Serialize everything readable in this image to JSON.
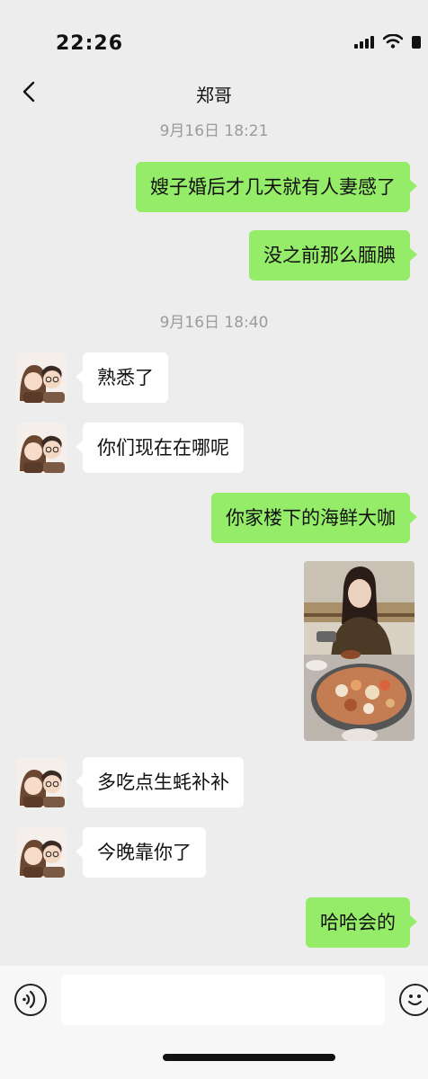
{
  "status": {
    "time": "22:26"
  },
  "nav": {
    "title": "郑哥"
  },
  "messages": [
    {
      "kind": "timestamp",
      "text": "9月16日 18:21"
    },
    {
      "kind": "out",
      "text": "嫂子婚后才几天就有人妻感了"
    },
    {
      "kind": "out",
      "text": "没之前那么腼腆"
    },
    {
      "kind": "timestamp",
      "text": "9月16日 18:40"
    },
    {
      "kind": "in",
      "text": "熟悉了"
    },
    {
      "kind": "in",
      "text": "你们现在在哪呢"
    },
    {
      "kind": "out",
      "text": "你家楼下的海鲜大咖"
    },
    {
      "kind": "out-image",
      "text": ""
    },
    {
      "kind": "in",
      "text": "多吃点生蚝补补"
    },
    {
      "kind": "in",
      "text": "今晚靠你了"
    },
    {
      "kind": "out",
      "text": "哈哈会的"
    }
  ],
  "colors": {
    "background": "#ededed",
    "outgoing_bubble": "#95ec69",
    "incoming_bubble": "#ffffff",
    "timestamp": "#9b9b9b"
  },
  "icons": {
    "back": "chevron-left-icon",
    "voice": "voice-icon",
    "emoji": "emoji-icon"
  }
}
